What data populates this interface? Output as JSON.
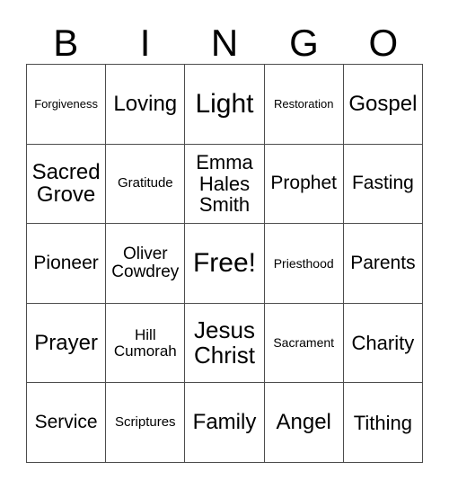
{
  "card": {
    "header_letters": [
      "B",
      "I",
      "N",
      "G",
      "O"
    ],
    "grid": {
      "rows": 5,
      "columns": 5,
      "border_color": "#4d4d4d",
      "background_color": "#ffffff",
      "text_color": "#000000"
    },
    "cells": [
      {
        "text": "Forgiveness",
        "size": "fs-13",
        "free": false
      },
      {
        "text": "Loving",
        "size": "fs-24",
        "free": false
      },
      {
        "text": "Light",
        "size": "fs-30",
        "free": false
      },
      {
        "text": "Restoration",
        "size": "fs-13",
        "free": false
      },
      {
        "text": "Gospel",
        "size": "fs-24",
        "free": false
      },
      {
        "text": "Sacred\nGrove",
        "size": "fs-24",
        "free": false
      },
      {
        "text": "Gratitude",
        "size": "fs-15",
        "free": false
      },
      {
        "text": "Emma\nHales\nSmith",
        "size": "fs-22",
        "free": false
      },
      {
        "text": "Prophet",
        "size": "fs-21",
        "free": false
      },
      {
        "text": "Fasting",
        "size": "fs-21",
        "free": false
      },
      {
        "text": "Pioneer",
        "size": "fs-21",
        "free": false
      },
      {
        "text": "Oliver\nCowdrey",
        "size": "fs-19",
        "free": false
      },
      {
        "text": "Free!",
        "size": "fs-30",
        "free": true
      },
      {
        "text": "Priesthood",
        "size": "fs-14",
        "free": false
      },
      {
        "text": "Parents",
        "size": "fs-21",
        "free": false
      },
      {
        "text": "Prayer",
        "size": "fs-24",
        "free": false
      },
      {
        "text": "Hill\nCumorah",
        "size": "fs-17",
        "free": false
      },
      {
        "text": "Jesus\nChrist",
        "size": "fs-26",
        "free": false
      },
      {
        "text": "Sacrament",
        "size": "fs-14",
        "free": false
      },
      {
        "text": "Charity",
        "size": "fs-22",
        "free": false
      },
      {
        "text": "Service",
        "size": "fs-21",
        "free": false
      },
      {
        "text": "Scriptures",
        "size": "fs-15",
        "free": false
      },
      {
        "text": "Family",
        "size": "fs-24",
        "free": false
      },
      {
        "text": "Angel",
        "size": "fs-24",
        "free": false
      },
      {
        "text": "Tithing",
        "size": "fs-22",
        "free": false
      }
    ]
  }
}
